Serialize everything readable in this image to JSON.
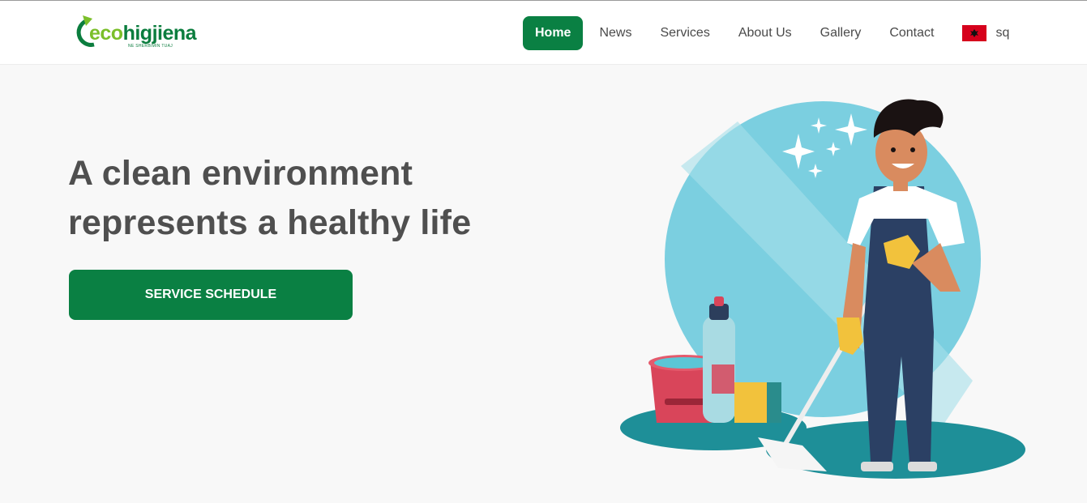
{
  "logo": {
    "eco": "eco",
    "name": "higjiena",
    "tagline": "NE SHERBIMIN TUAJ",
    "icon": "recycle-arrow-icon"
  },
  "nav": {
    "items": [
      {
        "label": "Home",
        "active": true
      },
      {
        "label": "News"
      },
      {
        "label": "Services"
      },
      {
        "label": "About Us"
      },
      {
        "label": "Gallery"
      },
      {
        "label": "Contact"
      }
    ],
    "language": {
      "code": "sq",
      "flag": "albania-flag-icon"
    }
  },
  "hero": {
    "title_line1": "A clean environment",
    "title_line2": "represents a healthy life",
    "cta_label": "SERVICE SCHEDULE"
  },
  "colors": {
    "brand_green": "#0a8043",
    "logo_light_green": "#7bbf2a",
    "heading": "#4f4f4f",
    "background": "#f8f8f8"
  }
}
